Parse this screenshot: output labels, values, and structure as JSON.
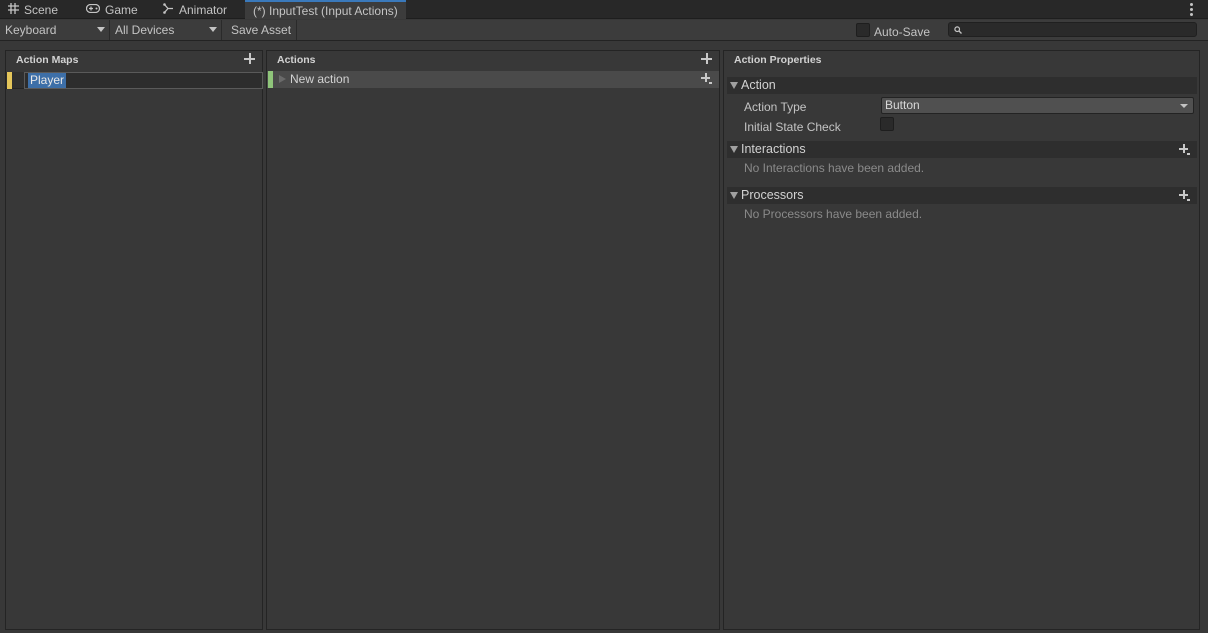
{
  "tabs": [
    {
      "label": "Scene",
      "icon": "grid-icon"
    },
    {
      "label": "Game",
      "icon": "gamepad-icon"
    },
    {
      "label": "Animator",
      "icon": "animator-icon"
    },
    {
      "label": "(*) InputTest (Input Actions)",
      "active": true
    }
  ],
  "toolbar": {
    "scheme_value": "Keyboard",
    "devices_value": "All Devices",
    "save_label": "Save Asset",
    "autosave_label": "Auto-Save",
    "autosave_checked": false,
    "search_placeholder": ""
  },
  "action_maps": {
    "header": "Action Maps",
    "items": [
      {
        "label": "Player",
        "color": "#e5c65a",
        "editing": true
      }
    ]
  },
  "actions": {
    "header": "Actions",
    "items": [
      {
        "label": "New action",
        "color": "#8fc57a"
      }
    ]
  },
  "properties": {
    "header": "Action Properties",
    "action_section": "Action",
    "action_type_label": "Action Type",
    "action_type_value": "Button",
    "initial_state_label": "Initial State Check",
    "initial_state_checked": false,
    "interactions_section": "Interactions",
    "interactions_empty": "No Interactions have been added.",
    "processors_section": "Processors",
    "processors_empty": "No Processors have been added."
  },
  "colors": {
    "accent_tab": "#3a79bb",
    "selection": "#3d6fa8",
    "map_marker": "#e5c65a",
    "action_marker": "#8fc57a"
  }
}
